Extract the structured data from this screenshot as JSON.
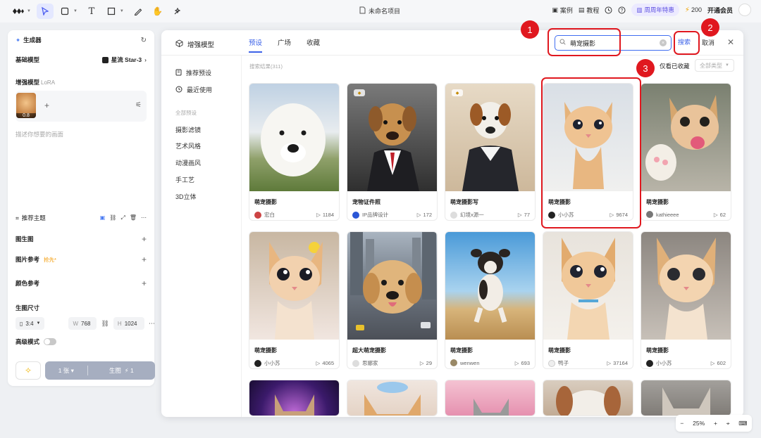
{
  "topbar": {
    "title": "未命名项目",
    "cases": "案例",
    "tutorial": "教程",
    "anniversary": "周周年特惠",
    "credits": "200",
    "vip": "开通会员"
  },
  "left": {
    "generator": "生成器",
    "base_model_label": "基础模型",
    "base_model_value": "星流 Star-3",
    "enhance_label": "增强模型",
    "enhance_sub": "LoRA",
    "lora_weight": "0.8",
    "prompt_placeholder": "描述你想要的画面",
    "recommend_topic": "推荐主题",
    "img2img": "图生图",
    "img_ref": "图片参考",
    "img_ref_tag": "抢先*",
    "color_ref": "颜色参考",
    "size_label": "生图尺寸",
    "ratio": "3:4",
    "w_label": "W",
    "w_value": "768",
    "h_label": "H",
    "h_value": "1024",
    "hd_mode": "高级模式",
    "count": "1 张",
    "gen_label": "生图",
    "gen_cost": "1"
  },
  "modal": {
    "title": "增强模型",
    "tabs": [
      "预设",
      "广场",
      "收藏"
    ],
    "search_value": "萌宠摄影",
    "search_btn": "搜索",
    "cancel_btn": "取消",
    "side_items": [
      "推荐预设",
      "最近使用"
    ],
    "side_group": "全部预设",
    "categories": [
      "摄影滤镜",
      "艺术风格",
      "动漫画风",
      "手工艺",
      "3D立体"
    ],
    "result_count": "搜索结果(311)",
    "only_fav": "仅看已收藏",
    "all_types": "全部类型"
  },
  "cards": [
    {
      "name": "萌宠摄影",
      "author": "宏白",
      "uses": "1184"
    },
    {
      "name": "宠物证件照",
      "author": "IP品牌设计",
      "uses": "172"
    },
    {
      "name": "萌宠摄影写",
      "author": "幻境x源一",
      "uses": "77"
    },
    {
      "name": "萌宠摄影",
      "author": "小小苏",
      "uses": "9674"
    },
    {
      "name": "萌宠摄影",
      "author": "kathieeee",
      "uses": "62"
    },
    {
      "name": "萌宠摄影",
      "author": "小小苏",
      "uses": "4065"
    },
    {
      "name": "超大萌宠摄影",
      "author": "思娜家",
      "uses": "29"
    },
    {
      "name": "萌宠摄影",
      "author": "wenwen",
      "uses": "693"
    },
    {
      "name": "萌宠摄影",
      "author": "鸭子",
      "uses": "37164"
    },
    {
      "name": "萌宠摄影",
      "author": "小小苏",
      "uses": "602"
    }
  ],
  "annotations": [
    "1",
    "2",
    "3"
  ],
  "zoom": "25%",
  "colors": {
    "accent": "#3c62e8",
    "annotation": "#e0181f"
  }
}
